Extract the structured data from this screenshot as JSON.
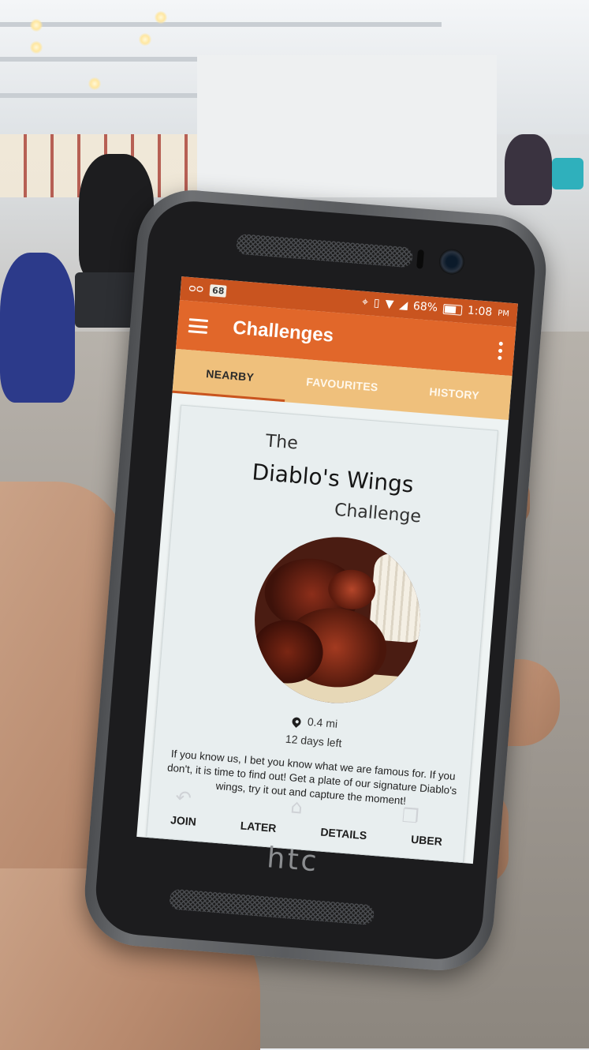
{
  "status_bar": {
    "notification_count": "68",
    "battery": "68%",
    "time": "1:08",
    "ampm": "PM",
    "icons": [
      "voicemail-icon",
      "gps-icon",
      "vibrate-icon",
      "wifi-icon",
      "signal-icon",
      "battery-icon"
    ]
  },
  "app_bar": {
    "title": "Challenges",
    "menu_icon": "hamburger-menu-icon",
    "overflow_icon": "more-vert-icon"
  },
  "tabs": [
    "NEARBY",
    "FAVOURITES",
    "HISTORY"
  ],
  "active_tab": "NEARBY",
  "card": {
    "title_prefix": "The",
    "title_main": "Diablo's Wings",
    "title_suffix": "Challenge",
    "distance": "0.4 mi",
    "days_left": "12 days left",
    "description": "If you know us, I bet you know what we are famous for. If you don't, it is time to find out! Get a plate of our signature Diablo's wings, try it out and capture the moment!",
    "actions": {
      "join": "JOIN",
      "later": "LATER",
      "details": "DETAILS",
      "uber": "UBER"
    }
  },
  "nav_bar": {
    "back_glyph": "↶",
    "home_glyph": "⌂",
    "recents_glyph": "❐"
  },
  "device_brand": "htc",
  "colors": {
    "status_bar": "#c9541f",
    "app_bar": "#e1672a",
    "tabs": "#efc07c",
    "card_bg": "#e8eeef"
  }
}
